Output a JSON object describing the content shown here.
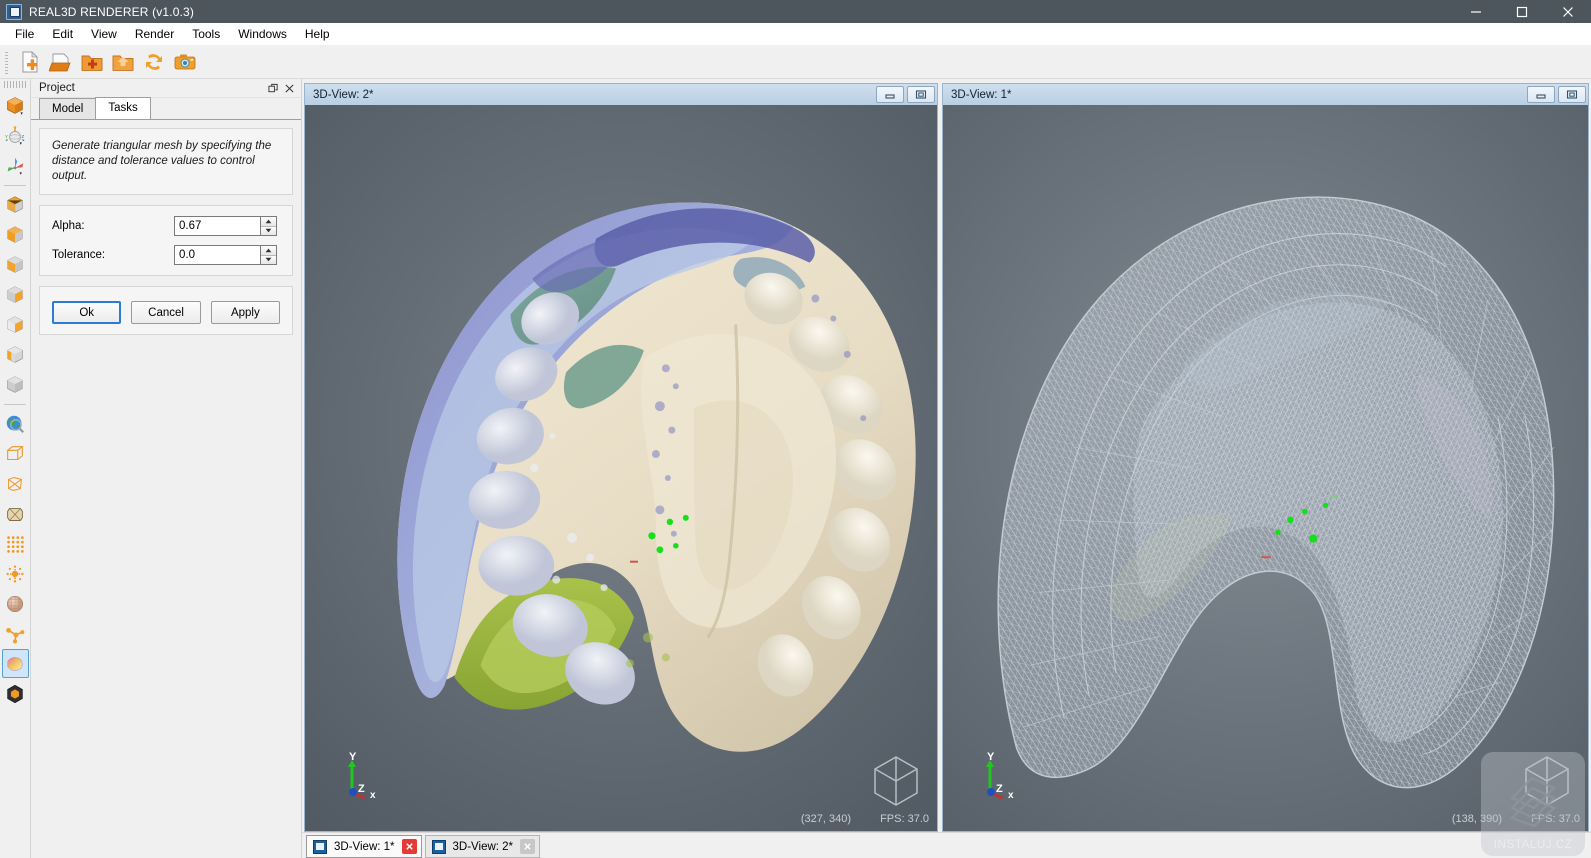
{
  "window": {
    "title": "REAL3D RENDERER (v1.0.3)",
    "app_icon": "app-logo-icon",
    "controls": {
      "minimize": "minimize-icon",
      "maximize": "maximize-icon",
      "close": "close-icon"
    }
  },
  "menubar": {
    "items": [
      {
        "label": "File"
      },
      {
        "label": "Edit"
      },
      {
        "label": "View"
      },
      {
        "label": "Render"
      },
      {
        "label": "Tools"
      },
      {
        "label": "Windows"
      },
      {
        "label": "Help"
      }
    ]
  },
  "toolbar": {
    "buttons": [
      {
        "name": "new-file-icon",
        "tip": "New"
      },
      {
        "name": "open-file-icon",
        "tip": "Open"
      },
      {
        "name": "add-folder-icon",
        "tip": "Add folder"
      },
      {
        "name": "open-folder-icon",
        "tip": "Open folder"
      },
      {
        "name": "refresh-icon",
        "tip": "Refresh"
      },
      {
        "name": "camera-icon",
        "tip": "Snapshot"
      }
    ]
  },
  "left_toolbar": {
    "buttons": [
      {
        "name": "orange-cube-icon"
      },
      {
        "name": "rotate-sphere-icon"
      },
      {
        "name": "axis-triad-icon"
      },
      {
        "name": "voxel-top-icon"
      },
      {
        "name": "voxel-bottom-icon"
      },
      {
        "name": "voxel-left-icon"
      },
      {
        "name": "voxel-right-icon"
      },
      {
        "name": "voxel-front-icon"
      },
      {
        "name": "voxel-half-icon"
      },
      {
        "name": "voxel-grey-icon"
      },
      {
        "name": "globe-zoom-icon"
      },
      {
        "name": "wireframe-box-icon"
      },
      {
        "name": "wireframe-prism-icon"
      },
      {
        "name": "shaded-cylinder-icon"
      },
      {
        "name": "point-grid-icon"
      },
      {
        "name": "point-burst-icon"
      },
      {
        "name": "textured-sphere-icon"
      },
      {
        "name": "node-graph-icon"
      },
      {
        "name": "color-gradient-icon",
        "active": true
      },
      {
        "name": "hexagon-solid-icon"
      }
    ]
  },
  "project_panel": {
    "title": "Project",
    "title_buttons": [
      {
        "name": "float-panel-icon"
      },
      {
        "name": "close-panel-icon"
      }
    ],
    "tabs": [
      {
        "label": "Model",
        "selected": false
      },
      {
        "label": "Tasks",
        "selected": true
      }
    ],
    "description": "Generate triangular mesh by specifying the distance and tolerance values to control output.",
    "fields": [
      {
        "label": "Alpha:",
        "value": "0.67",
        "name": "alpha-input"
      },
      {
        "label": "Tolerance:",
        "value": "0.0",
        "name": "tolerance-input"
      }
    ],
    "buttons": [
      {
        "label": "Ok",
        "default": true
      },
      {
        "label": "Cancel",
        "default": false
      },
      {
        "label": "Apply",
        "default": false
      }
    ]
  },
  "viewports": [
    {
      "title": "3D-View: 2*",
      "coords": "(327, 340)",
      "fps": "FPS: 37.0",
      "axis_labels": {
        "x": "x",
        "y": "Y",
        "z": "Z"
      },
      "mode": "shaded"
    },
    {
      "title": "3D-View: 1*",
      "coords": "(138, 390)",
      "fps": "FPS: 37.0",
      "axis_labels": {
        "x": "x",
        "y": "Y",
        "z": "Z"
      },
      "mode": "wireframe"
    }
  ],
  "viewport_buttons": {
    "minimize": "view-minimize-icon",
    "restore": "view-restore-icon"
  },
  "taskbar": {
    "tabs": [
      {
        "label": "3D-View: 1*",
        "active": true,
        "close_highlight": true
      },
      {
        "label": "3D-View: 2*",
        "active": false,
        "close_highlight": false
      }
    ]
  },
  "watermark": {
    "text": "INSTALUJ.CZ"
  },
  "colors": {
    "titlebar": "#4d565c",
    "accent": "#2c7cd6",
    "viewport_header": "#c4d6e8",
    "toolbar_orange": "#e8821e",
    "close_red": "#e53935"
  }
}
